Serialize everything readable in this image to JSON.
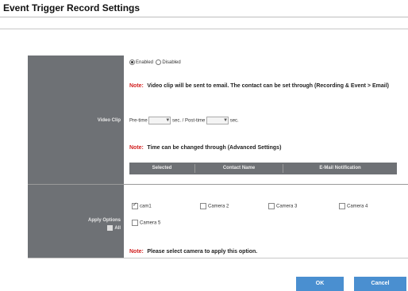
{
  "page": {
    "title": "Event Trigger Record Settings"
  },
  "video_clip": {
    "row_label": "Video Clip",
    "enabled_label": "Enabled",
    "disabled_label": "Disabled",
    "enabled_selected": true,
    "note_label": "Note:",
    "note_email": "Video clip will be sent to email. The contact can be set through (Recording & Event > Email)",
    "pre_time_label": "Pre-time",
    "pre_time_value": "",
    "pre_unit": "sec. / Post-time",
    "post_time_value": "",
    "post_unit": "sec.",
    "note_time": "Time can be changed through (Advanced Settings)",
    "table_headers": [
      "Selected",
      "Contact Name",
      "E-Mail Notification"
    ]
  },
  "apply_options": {
    "row_label": "Apply Options",
    "all_label": "All",
    "cameras": [
      {
        "label": "cam1",
        "checked": true
      },
      {
        "label": "Camera 2",
        "checked": false
      },
      {
        "label": "Camera 3",
        "checked": false
      },
      {
        "label": "Camera 4",
        "checked": false
      },
      {
        "label": "Camera 5",
        "checked": false
      }
    ],
    "note_label": "Note:",
    "note_text": "Please select camera to apply this option."
  },
  "buttons": {
    "ok": "OK",
    "cancel": "Cancel"
  },
  "colors": {
    "label_bg": "#6e7175",
    "note_red": "#d21f1f",
    "button_blue": "#4a8fd0"
  }
}
